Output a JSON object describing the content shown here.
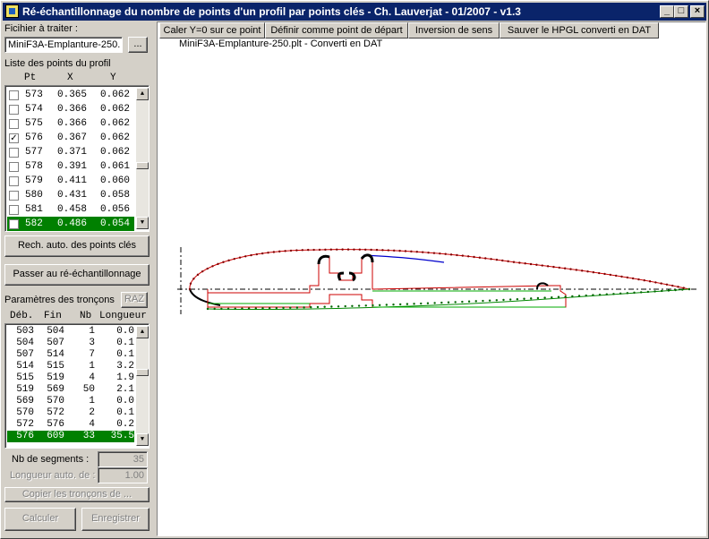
{
  "window": {
    "title": "Ré-échantillonnage du nombre de points d'un profil par points clés - Ch. Lauverjat - 01/2007 - v1.3",
    "minimize": "_",
    "maximize": "□",
    "close": "×"
  },
  "file": {
    "label": "Ficihier à traiter :",
    "value": "MiniF3A-Emplanture-250.",
    "browse_label": "..."
  },
  "points": {
    "label": "Liste des points du profil",
    "headers": {
      "pt": "Pt",
      "x": "X",
      "y": "Y"
    },
    "rows": [
      {
        "pt": "573",
        "x": "0.365",
        "y": "0.062",
        "checked": ""
      },
      {
        "pt": "574",
        "x": "0.366",
        "y": "0.062",
        "checked": ""
      },
      {
        "pt": "575",
        "x": "0.366",
        "y": "0.062",
        "checked": ""
      },
      {
        "pt": "576",
        "x": "0.367",
        "y": "0.062",
        "checked": "✓"
      },
      {
        "pt": "577",
        "x": "0.371",
        "y": "0.062",
        "checked": ""
      },
      {
        "pt": "578",
        "x": "0.391",
        "y": "0.061",
        "checked": ""
      },
      {
        "pt": "579",
        "x": "0.411",
        "y": "0.060",
        "checked": ""
      },
      {
        "pt": "580",
        "x": "0.431",
        "y": "0.058",
        "checked": ""
      },
      {
        "pt": "581",
        "x": "0.458",
        "y": "0.056",
        "checked": ""
      },
      {
        "pt": "582",
        "x": "0.486",
        "y": "0.054",
        "checked": ""
      }
    ],
    "selected_index": 9
  },
  "buttons": {
    "auto_keypoints": "Rech. auto. des points clés",
    "resample": "Passer au ré-échantillonnage",
    "raz": "RAZ",
    "copy_sections": "Copier les tronçons de ...",
    "compute": "Calculer",
    "save": "Enregistrer"
  },
  "sections": {
    "label": "Paramètres des tronçons",
    "headers": {
      "deb": "Déb.",
      "fin": "Fin",
      "nb": "Nb",
      "len": "Longueur"
    },
    "rows": [
      {
        "deb": "503",
        "fin": "504",
        "nb": "1",
        "len": "0.0"
      },
      {
        "deb": "504",
        "fin": "507",
        "nb": "3",
        "len": "0.1"
      },
      {
        "deb": "507",
        "fin": "514",
        "nb": "7",
        "len": "0.1"
      },
      {
        "deb": "514",
        "fin": "515",
        "nb": "1",
        "len": "3.2"
      },
      {
        "deb": "515",
        "fin": "519",
        "nb": "4",
        "len": "1.9"
      },
      {
        "deb": "519",
        "fin": "569",
        "nb": "50",
        "len": "2.1"
      },
      {
        "deb": "569",
        "fin": "570",
        "nb": "1",
        "len": "0.0"
      },
      {
        "deb": "570",
        "fin": "572",
        "nb": "2",
        "len": "0.1"
      },
      {
        "deb": "572",
        "fin": "576",
        "nb": "4",
        "len": "0.2"
      },
      {
        "deb": "576",
        "fin": "609",
        "nb": "33",
        "len": "35.5"
      }
    ],
    "selected_index": 9
  },
  "segments": {
    "count_label": "Nb de segments :",
    "count_value": "35",
    "autolen_label": "Longueur auto. de :",
    "autolen_value": "1.00"
  },
  "toolbar": {
    "set_y0": "Caler Y=0 sur ce point",
    "set_start": "Définir comme point de départ",
    "invert": "Inversion de sens",
    "save_hpgl": "Sauver le HPGL converti en DAT"
  },
  "canvas": {
    "caption": "MiniF3A-Emplanture-250.plt - Converti en DAT",
    "colors": {
      "upper": "#cc0000",
      "upper2": "#0000cc",
      "lower": "#008800",
      "inner": "#cc0000",
      "inner2": "#00aa00",
      "axis": "#000000"
    }
  }
}
